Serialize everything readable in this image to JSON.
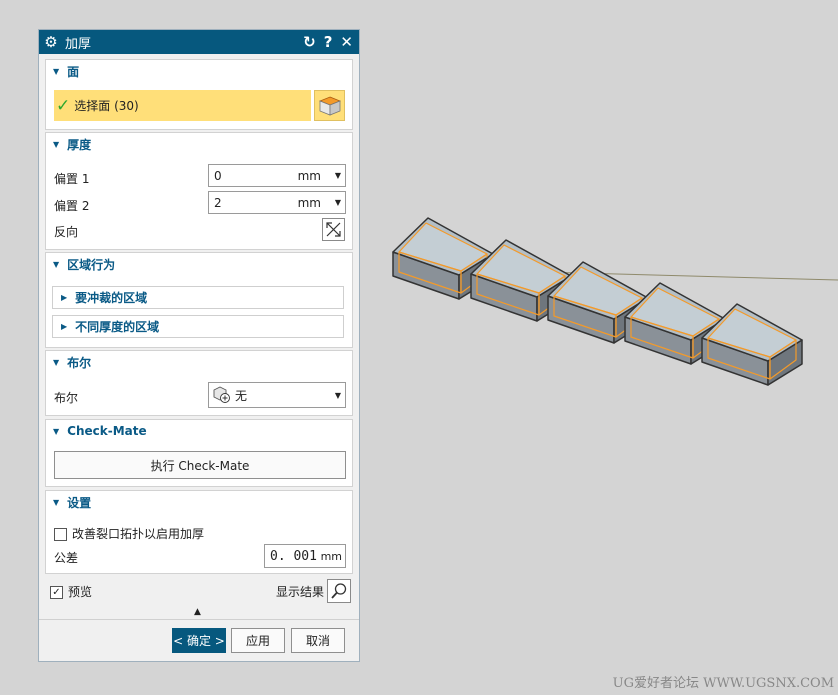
{
  "dialog": {
    "title": "加厚",
    "icons": [
      "gear-icon",
      "reset-icon",
      "help-icon",
      "close-icon"
    ],
    "face_group": {
      "heading": "面",
      "select_label": "选择面 (30)",
      "selected": true
    },
    "thickness_group": {
      "heading": "厚度",
      "offset1_label": "偏置 1",
      "offset1_value": "0",
      "offset1_unit": "mm",
      "offset2_label": "偏置 2",
      "offset2_value": "2",
      "offset2_unit": "mm",
      "reverse_label": "反向"
    },
    "region_group": {
      "heading": "区域行为",
      "sub1": "要冲裁的区域",
      "sub2": "不同厚度的区域"
    },
    "boolean_group": {
      "heading": "布尔",
      "label": "布尔",
      "value": "无"
    },
    "checkmate_group": {
      "heading": "Check-Mate",
      "button": "执行 Check-Mate"
    },
    "settings_group": {
      "heading": "设置",
      "improve_label": "改善裂口拓扑以启用加厚",
      "improve_checked": false,
      "tolerance_label": "公差",
      "tolerance_value": "0. 001",
      "tolerance_unit": "mm"
    },
    "preview_label": "预览",
    "preview_checked": true,
    "show_result_label": "显示结果",
    "ok_label": "< 确定 >",
    "apply_label": "应用",
    "cancel_label": "取消"
  },
  "colors": {
    "title_bar": "#06587e",
    "selection_highlight": "#ffdf79",
    "heading_text": "#0a5a86",
    "edge_highlight": "#f39a2a"
  },
  "watermark": "UG爱好者论坛 WWW.UGSNX.COM"
}
